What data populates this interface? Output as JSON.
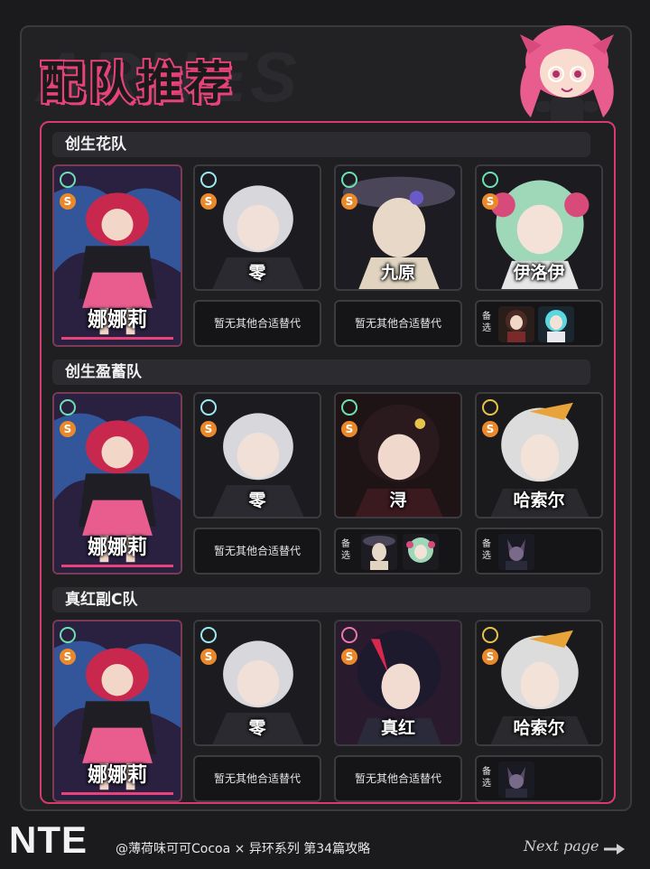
{
  "header": {
    "title": "配队推荐",
    "bg_text": "ARNES"
  },
  "teams": [
    {
      "label": "创生花队",
      "main": {
        "name": "娜娜莉"
      },
      "members": [
        {
          "name": "零",
          "element": "cyan",
          "rank": "S"
        },
        {
          "name": "九原",
          "element": "green",
          "rank": "S"
        },
        {
          "name": "伊洛伊",
          "element": "green",
          "rank": "S"
        }
      ],
      "alternates": [
        {
          "type": "text",
          "text": "暂无其他合适替代"
        },
        {
          "type": "text",
          "text": "暂无其他合适替代"
        },
        {
          "type": "images",
          "label": "备选"
        }
      ]
    },
    {
      "label": "创生盈蓄队",
      "main": {
        "name": "娜娜莉"
      },
      "members": [
        {
          "name": "零",
          "element": "cyan",
          "rank": "S"
        },
        {
          "name": "浔",
          "element": "green",
          "rank": "S"
        },
        {
          "name": "哈索尔",
          "element": "gold",
          "rank": "S"
        }
      ],
      "alternates": [
        {
          "type": "text",
          "text": "暂无其他合适替代"
        },
        {
          "type": "images",
          "label": "备选"
        },
        {
          "type": "images",
          "label": "备选"
        }
      ]
    },
    {
      "label": "真红副C队",
      "main": {
        "name": "娜娜莉"
      },
      "members": [
        {
          "name": "零",
          "element": "cyan",
          "rank": "S"
        },
        {
          "name": "真红",
          "element": "pink",
          "rank": "S"
        },
        {
          "name": "哈索尔",
          "element": "gold",
          "rank": "S"
        }
      ],
      "alternates": [
        {
          "type": "text",
          "text": "暂无其他合适替代"
        },
        {
          "type": "text",
          "text": "暂无其他合适替代"
        },
        {
          "type": "images",
          "label": "备选"
        }
      ]
    }
  ],
  "footer": {
    "logo": "NTE",
    "credit": "@薄荷味可可Cocoa × 异环系列 第34篇攻略",
    "next": "Next page"
  },
  "colors": {
    "accent": "#e8427a",
    "panel": "#1f1f22"
  }
}
